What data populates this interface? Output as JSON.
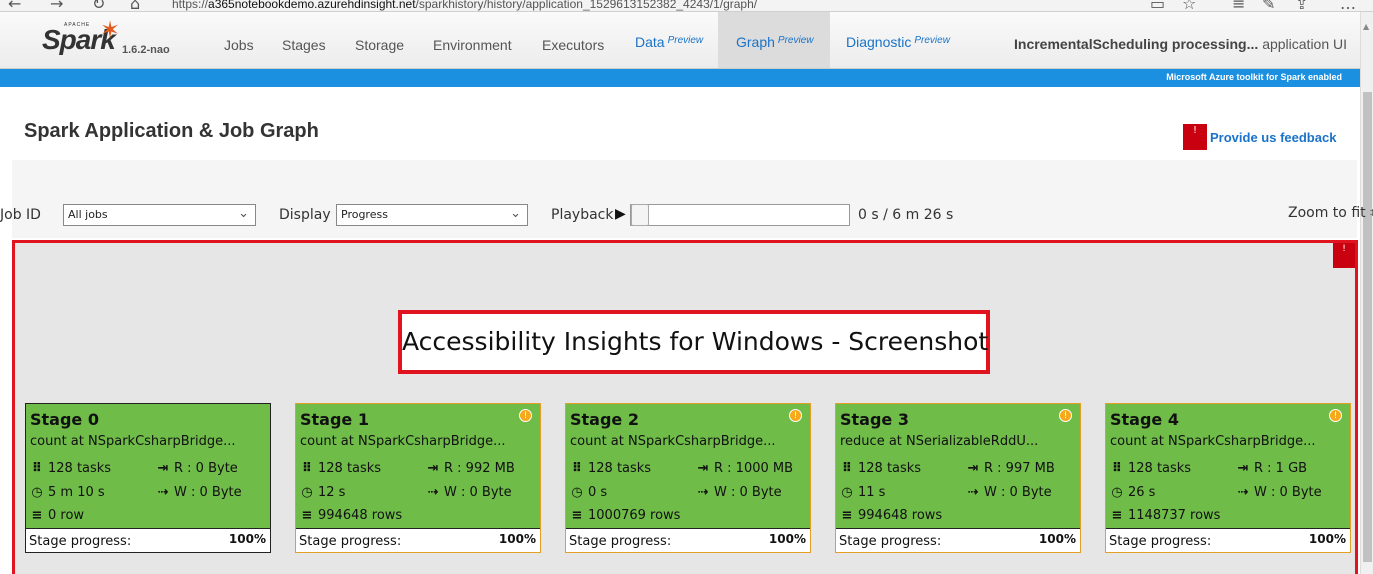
{
  "browser": {
    "url_prefix": "https://",
    "url_host": "a365notebookdemo.azurehdinsight.net",
    "url_path": "/sparkhistory/history/application_1529613152382_4243/1/graph/"
  },
  "spark_nav": {
    "logo_text": "Spark",
    "logo_apache": "APACHE",
    "version": "1.6.2-nao",
    "items": [
      {
        "label": "Jobs"
      },
      {
        "label": "Stages"
      },
      {
        "label": "Storage"
      },
      {
        "label": "Environment"
      },
      {
        "label": "Executors"
      },
      {
        "label": "Data",
        "preview": "Preview"
      },
      {
        "label": "Graph",
        "preview": "Preview"
      },
      {
        "label": "Diagnostic",
        "preview": "Preview"
      }
    ],
    "app_name": "IncrementalScheduling processing...",
    "app_suffix": "application UI"
  },
  "azure_banner": "Microsoft Azure toolkit for Spark enabled",
  "page": {
    "title": "Spark Application & Job Graph",
    "feedback_label": "Provide us feedback"
  },
  "controls": {
    "job_id_label": "Job ID",
    "job_id_value": "All jobs",
    "display_label": "Display",
    "display_value": "Progress",
    "playback_label": "Playback",
    "playback_progress": 0,
    "time_text": "0 s  / 6 m 26 s",
    "zoom_label": "Zoom to fit"
  },
  "overlay_label": "Accessibility Insights for Windows - Screenshot",
  "colors": {
    "stage_fill": "#6fbc49",
    "highlight": "#e0141e",
    "link": "#1a73c8",
    "azure_bar": "#1b8fe0"
  },
  "stages": [
    {
      "name": "Stage 0",
      "desc": "count at NSparkCsharpBridge...",
      "tasks": "128 tasks",
      "read": "R : 0 Byte",
      "time": "5 m 10 s",
      "write": "W : 0 Byte",
      "rows": "0 row",
      "progress_label": "Stage progress:",
      "progress": "100%",
      "warning": false
    },
    {
      "name": "Stage 1",
      "desc": "count at NSparkCsharpBridge...",
      "tasks": "128 tasks",
      "read": "R : 992 MB",
      "time": "12 s",
      "write": "W : 0 Byte",
      "rows": "994648 rows",
      "progress_label": "Stage progress:",
      "progress": "100%",
      "warning": true
    },
    {
      "name": "Stage 2",
      "desc": "count at NSparkCsharpBridge...",
      "tasks": "128 tasks",
      "read": "R : 1000 MB",
      "time": "0 s",
      "write": "W : 0 Byte",
      "rows": "1000769 rows",
      "progress_label": "Stage progress:",
      "progress": "100%",
      "warning": true
    },
    {
      "name": "Stage 3",
      "desc": "reduce at NSerializableRddU...",
      "tasks": "128 tasks",
      "read": "R : 997 MB",
      "time": "11 s",
      "write": "W : 0 Byte",
      "rows": "994648 rows",
      "progress_label": "Stage progress:",
      "progress": "100%",
      "warning": true
    },
    {
      "name": "Stage 4",
      "desc": "count at NSparkCsharpBridge...",
      "tasks": "128 tasks",
      "read": "R : 1 GB",
      "time": "26 s",
      "write": "W : 0 Byte",
      "rows": "1148737 rows",
      "progress_label": "Stage progress:",
      "progress": "100%",
      "warning": true
    }
  ]
}
